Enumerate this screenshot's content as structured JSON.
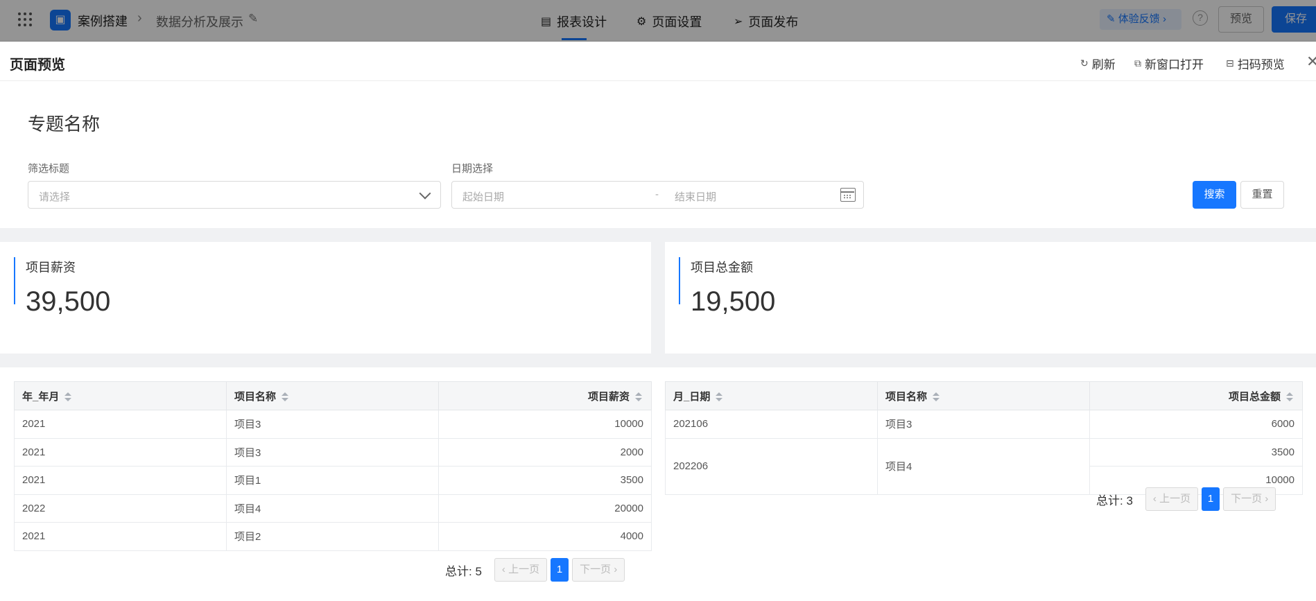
{
  "app": {
    "crumb_app": "案例搭建",
    "crumb_page": "数据分析及展示",
    "nav": [
      "报表设计",
      "页面设置",
      "页面发布"
    ],
    "feedback": "体验反馈",
    "preview_button": "预览",
    "save_button": "保存"
  },
  "drawer": {
    "title": "页面预览",
    "actions": [
      "刷新",
      "新窗口打开",
      "扫码预览"
    ]
  },
  "filter": {
    "topic": "专题名称",
    "filter_label": "筛选标题",
    "select_placeholder": "请选择",
    "date_label": "日期选择",
    "start_placeholder": "起始日期",
    "dash": "-",
    "end_placeholder": "结束日期",
    "search_button": "搜索",
    "reset_button": "重置"
  },
  "kpis": [
    {
      "label": "项目薪资",
      "value": "39,500"
    },
    {
      "label": "项目总金额",
      "value": "19,500"
    }
  ],
  "table1": {
    "headers": [
      "年_年月",
      "项目名称",
      "项目薪资"
    ],
    "rows": [
      [
        "2021",
        "项目3",
        "10000"
      ],
      [
        "2021",
        "项目3",
        "2000"
      ],
      [
        "2021",
        "项目1",
        "3500"
      ],
      [
        "2022",
        "项目4",
        "20000"
      ],
      [
        "2021",
        "项目2",
        "4000"
      ]
    ],
    "total": "总计: 5",
    "prev": "上一页",
    "page": "1",
    "next": "下一页"
  },
  "table2": {
    "headers": [
      "月_日期",
      "项目名称",
      "项目总金额"
    ],
    "rows": [
      {
        "date": "202106",
        "name": "项目3",
        "amounts": [
          "6000"
        ]
      },
      {
        "date": "202206",
        "name": "项目4",
        "amounts": [
          "3500",
          "10000"
        ]
      }
    ],
    "total": "总计: 3",
    "prev": "上一页",
    "page": "1",
    "next": "下一页"
  },
  "colors": {
    "accent": "#1677ff"
  }
}
